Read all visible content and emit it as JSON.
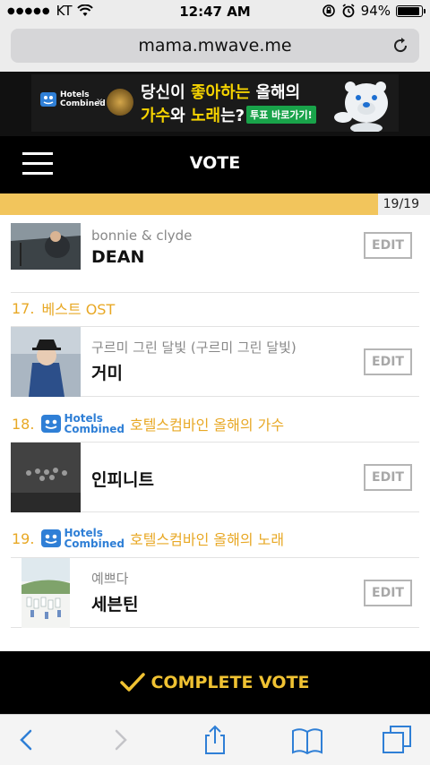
{
  "status_bar": {
    "carrier": "KT",
    "time": "12:47 AM",
    "battery": "94%",
    "battery_level": 0.94
  },
  "browser": {
    "url": "mama.mwave.me"
  },
  "banner": {
    "brand": [
      "Hotels",
      "Combined"
    ],
    "separator": "×",
    "line1_pre": "당신이 ",
    "line1_highlight": "좋아하는",
    "line1_post": " 올해의",
    "line2_highlight_a": "가수",
    "line2_mid": "와 ",
    "line2_highlight_b": "노래",
    "line2_post": "는?",
    "cta": "투표 바로가기!"
  },
  "nav": {
    "title": "VOTE"
  },
  "progress": {
    "current": 19,
    "total": 19,
    "label": "19/19"
  },
  "items": [
    {
      "subtitle": "bonnie & clyde",
      "name": "DEAN",
      "edit": "EDIT"
    },
    {
      "subtitle": "구르미 그린 달빛 (구르미 그린 달빛)",
      "name": "거미",
      "edit": "EDIT"
    },
    {
      "subtitle": "",
      "name": "인피니트",
      "edit": "EDIT"
    },
    {
      "subtitle": "예쁘다",
      "name": "세븐틴",
      "edit": "EDIT"
    }
  ],
  "categories": [
    {
      "number": "17.",
      "label": "베스트 OST"
    },
    {
      "number": "18.",
      "label": "호텔스컴바인 올해의 가수",
      "brand": [
        "Hotels",
        "Combined"
      ]
    },
    {
      "number": "19.",
      "label": "호텔스컴바인 올해의 노래",
      "brand": [
        "Hotels",
        "Combined"
      ]
    }
  ],
  "complete_button": {
    "label": "COMPLETE VOTE"
  },
  "colors": {
    "accent": "#f0c232",
    "category": "#e8a825",
    "progress_fill": "#f2c55c",
    "brand_blue": "#2f7fd6"
  }
}
